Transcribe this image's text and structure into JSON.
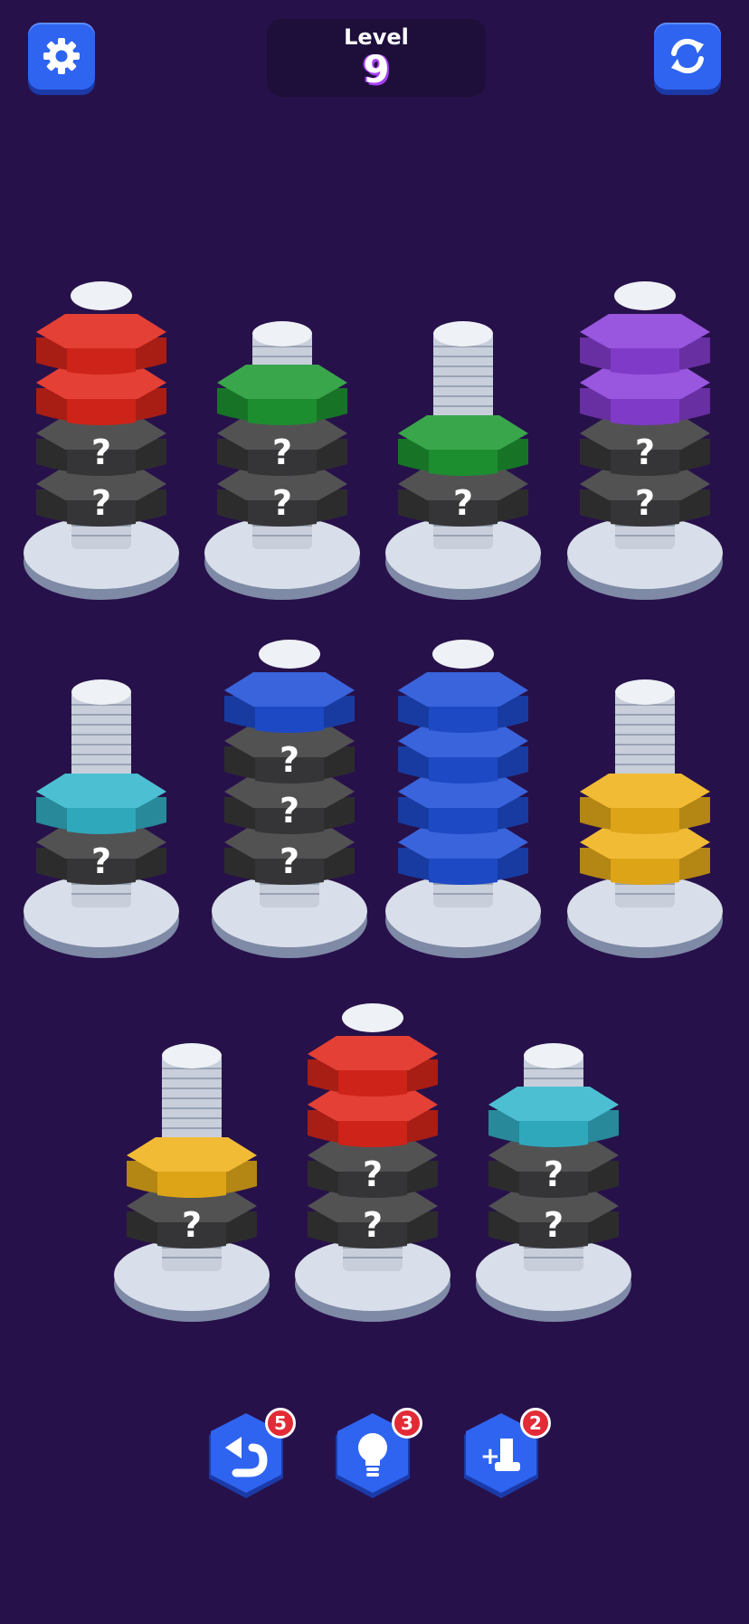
{
  "header": {
    "level_label": "Level",
    "level_number": "9",
    "settings_icon": "gear-icon",
    "restart_icon": "refresh-icon"
  },
  "colors": {
    "background": "#27114a",
    "red": "#e0261a",
    "green": "#1f9a34",
    "purple": "#8b3fd9",
    "cyan": "#34b7cc",
    "blue": "#1f4fd6",
    "yellow": "#f0b21a",
    "hidden": "#3a3a3c",
    "button_blue": "#2f64f0"
  },
  "hidden_mark": "?",
  "bolts": [
    {
      "nuts": [
        "hidden",
        "hidden",
        "red",
        "red"
      ]
    },
    {
      "nuts": [
        "hidden",
        "hidden",
        "green"
      ]
    },
    {
      "nuts": [
        "hidden",
        "green"
      ]
    },
    {
      "nuts": [
        "hidden",
        "hidden",
        "purple",
        "purple"
      ]
    },
    {
      "nuts": [
        "hidden",
        "cyan"
      ]
    },
    {
      "nuts": [
        "hidden",
        "hidden",
        "hidden",
        "blue"
      ]
    },
    {
      "nuts": [
        "blue",
        "blue",
        "blue",
        "blue"
      ]
    },
    {
      "nuts": [
        "yellow",
        "yellow"
      ]
    },
    {
      "nuts": [
        "hidden",
        "yellow"
      ]
    },
    {
      "nuts": [
        "hidden",
        "hidden",
        "red",
        "red"
      ]
    },
    {
      "nuts": [
        "hidden",
        "hidden",
        "cyan"
      ]
    }
  ],
  "boosters": [
    {
      "name": "undo",
      "icon": "undo-icon",
      "count": "5"
    },
    {
      "name": "hint",
      "icon": "lightbulb-icon",
      "count": "3"
    },
    {
      "name": "add-bolt",
      "icon": "add-bolt-icon",
      "count": "2"
    }
  ]
}
